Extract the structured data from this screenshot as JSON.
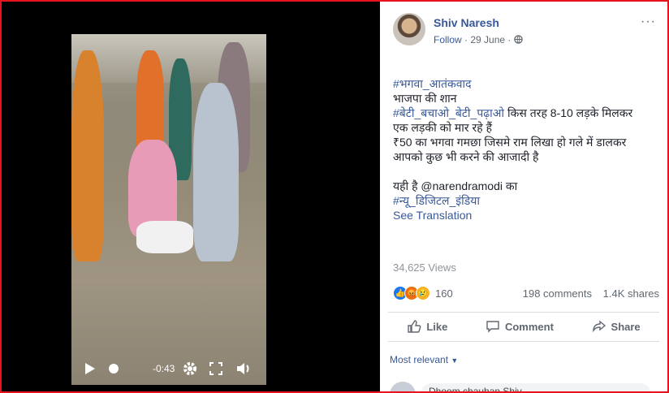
{
  "post": {
    "author": "Shiv Naresh",
    "follow_label": "Follow",
    "separator": "·",
    "date": "29 June",
    "separator2": "·",
    "more": "···",
    "lines": [
      {
        "text": "#भगवा_आतंकवाद",
        "tag": true
      },
      {
        "text": "भाजपा की शान",
        "tag": false
      },
      {
        "tag_part": "#बेटी_बचाओ_बेटी_पढ़ाओ",
        "rest": " किस तरह 8-10 लड़के मिलकर"
      },
      {
        "text": "एक लड़की को मार रहे हैं",
        "tag": false
      },
      {
        "text": "₹50 का भगवा गमछा जिसमे राम लिखा हो गले में डालकर",
        "tag": false
      },
      {
        "text": "आपको कुछ भी करने की आजादी है",
        "tag": false
      },
      {
        "text": "",
        "tag": false
      },
      {
        "text": "यही है @narendramodi का",
        "tag": false
      },
      {
        "text": "#न्यू_डिजिटल_इंडिया",
        "tag": true
      },
      {
        "text": "See Translation",
        "tag": true
      }
    ],
    "views": "34,625 Views",
    "reaction_count": "160",
    "comments": "198 comments",
    "shares": "1.4K shares"
  },
  "video": {
    "time_remaining": "-0:43"
  },
  "actions": {
    "like": "Like",
    "comment": "Comment",
    "share": "Share"
  },
  "comments_section": {
    "sort_label": "Most relevant",
    "partial_comment": "Dhoom chauhan Shiv ..."
  },
  "colors": {
    "frame_border": "#e8141b",
    "link": "#385898",
    "muted": "#606770"
  }
}
